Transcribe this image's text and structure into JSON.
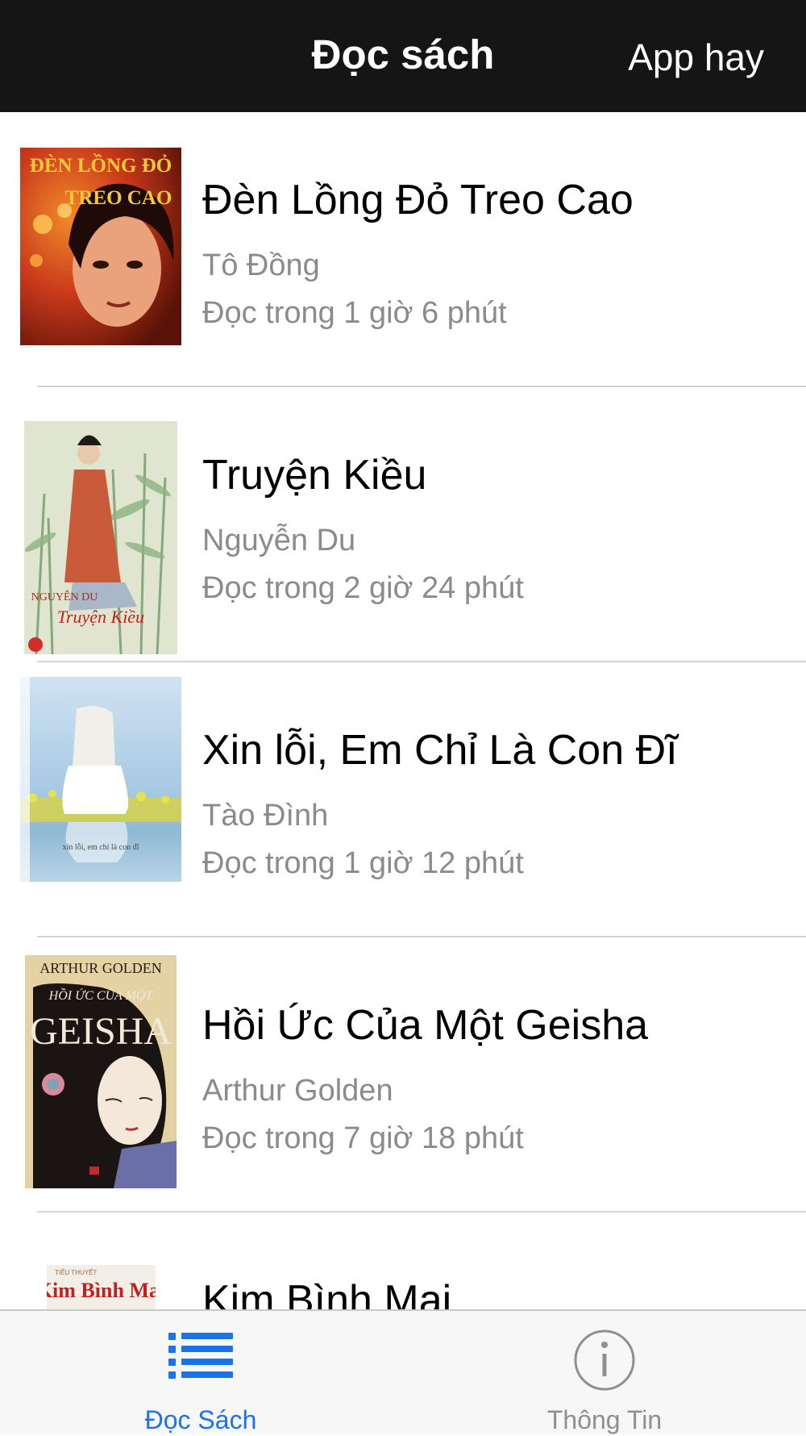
{
  "nav": {
    "title": "Đọc sách",
    "right_button": "App hay"
  },
  "books": [
    {
      "title": "Đèn Lồng Đỏ Treo Cao",
      "author": "Tô Đồng",
      "read_time": "Đọc trong 1 giờ 6 phút",
      "cover_text": "ĐÈN LỒNG ĐỎ TREO CAO"
    },
    {
      "title": "Truyện Kiều",
      "author": "Nguyễn Du",
      "read_time": "Đọc trong 2 giờ 24 phút",
      "cover_text": "NGUYỄN DU"
    },
    {
      "title": "Xin lỗi, Em Chỉ Là Con Đĩ",
      "author": "Tào Đình",
      "read_time": "Đọc trong 1 giờ 12 phút",
      "cover_text": ""
    },
    {
      "title": "Hồi Ức Của Một Geisha",
      "author": "Arthur Golden",
      "read_time": "Đọc trong 7 giờ 18 phút",
      "cover_text": "ARTHUR GOLDEN"
    },
    {
      "title": "Kim Bình Mai",
      "author": "",
      "read_time": "",
      "cover_text": "Kim Bình Mai"
    }
  ],
  "tabs": [
    {
      "label": "Đọc Sách",
      "icon": "list-icon",
      "active": true
    },
    {
      "label": "Thông Tin",
      "icon": "info-icon",
      "active": false
    }
  ],
  "colors": {
    "navbar_bg": "#151515",
    "tab_active": "#1a73e8",
    "tab_inactive": "#8e8e93",
    "secondary_text": "#8a8a8f"
  }
}
